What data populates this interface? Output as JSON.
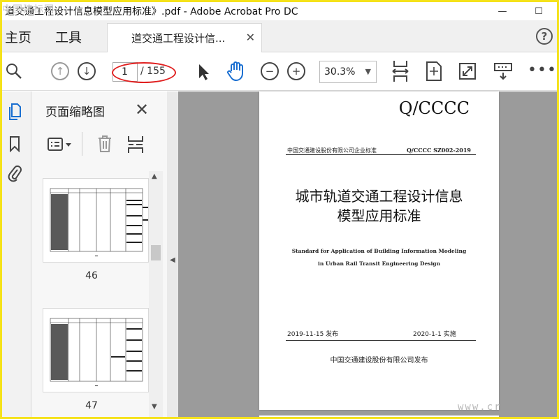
{
  "titlebar": {
    "title": "道交通工程设计信息模型应用标准》.pdf - Adobe Acrobat Pro DC",
    "watermark": "中国建标网"
  },
  "tabs": {
    "home": "主页",
    "tools": "工具",
    "document": "道交通工程设计信..."
  },
  "toolbar": {
    "current_page": "1",
    "total_pages": "/ 155",
    "zoom": "30.3%"
  },
  "thumbnails_panel": {
    "title": "页面缩略图",
    "thumbnails": [
      {
        "label": "46"
      },
      {
        "label": "47"
      }
    ]
  },
  "page": {
    "code": "Q/CCCC",
    "organization_standard": "中国交通建设股份有限公司企业标准",
    "standard_number": "Q/CCCC SZ002-2019",
    "title_line1": "城市轨道交通工程设计信息",
    "title_line2": "模型应用标准",
    "english_line1": "Standard for Application of Building Information Modeling",
    "english_line2": "in Urban Rail Transit Engineering Design",
    "issue_date": "2019-11-15 发布",
    "effective_date": "2020-1-1 实施",
    "publisher": "中国交通建设股份有限公司发布"
  },
  "watermark_bottom": "www.cr"
}
